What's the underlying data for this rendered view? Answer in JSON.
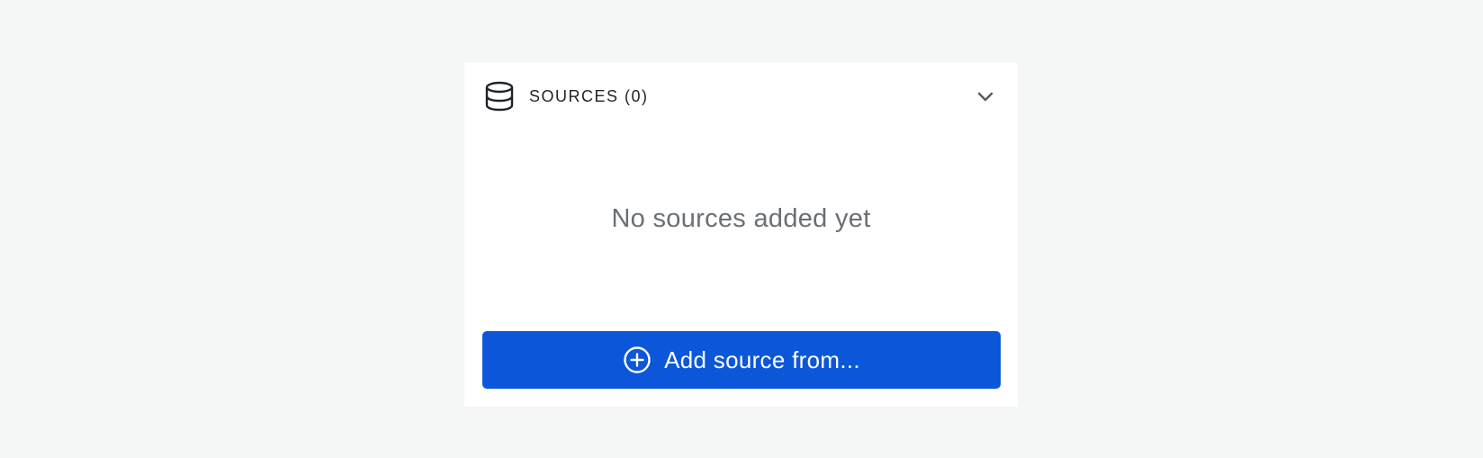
{
  "sources": {
    "title": "SOURCES (0)",
    "header_icon": "database-icon",
    "toggle_icon": "chevron-down-icon",
    "empty_message": "No sources added yet",
    "add_button": {
      "icon": "plus-circle-icon",
      "label": "Add source from..."
    }
  },
  "colors": {
    "page_background": "#f5f6f6",
    "panel_background": "#ffffff",
    "primary_button": "#0c57d9",
    "empty_text": "#6a6f75",
    "title_text": "#1f2328"
  }
}
